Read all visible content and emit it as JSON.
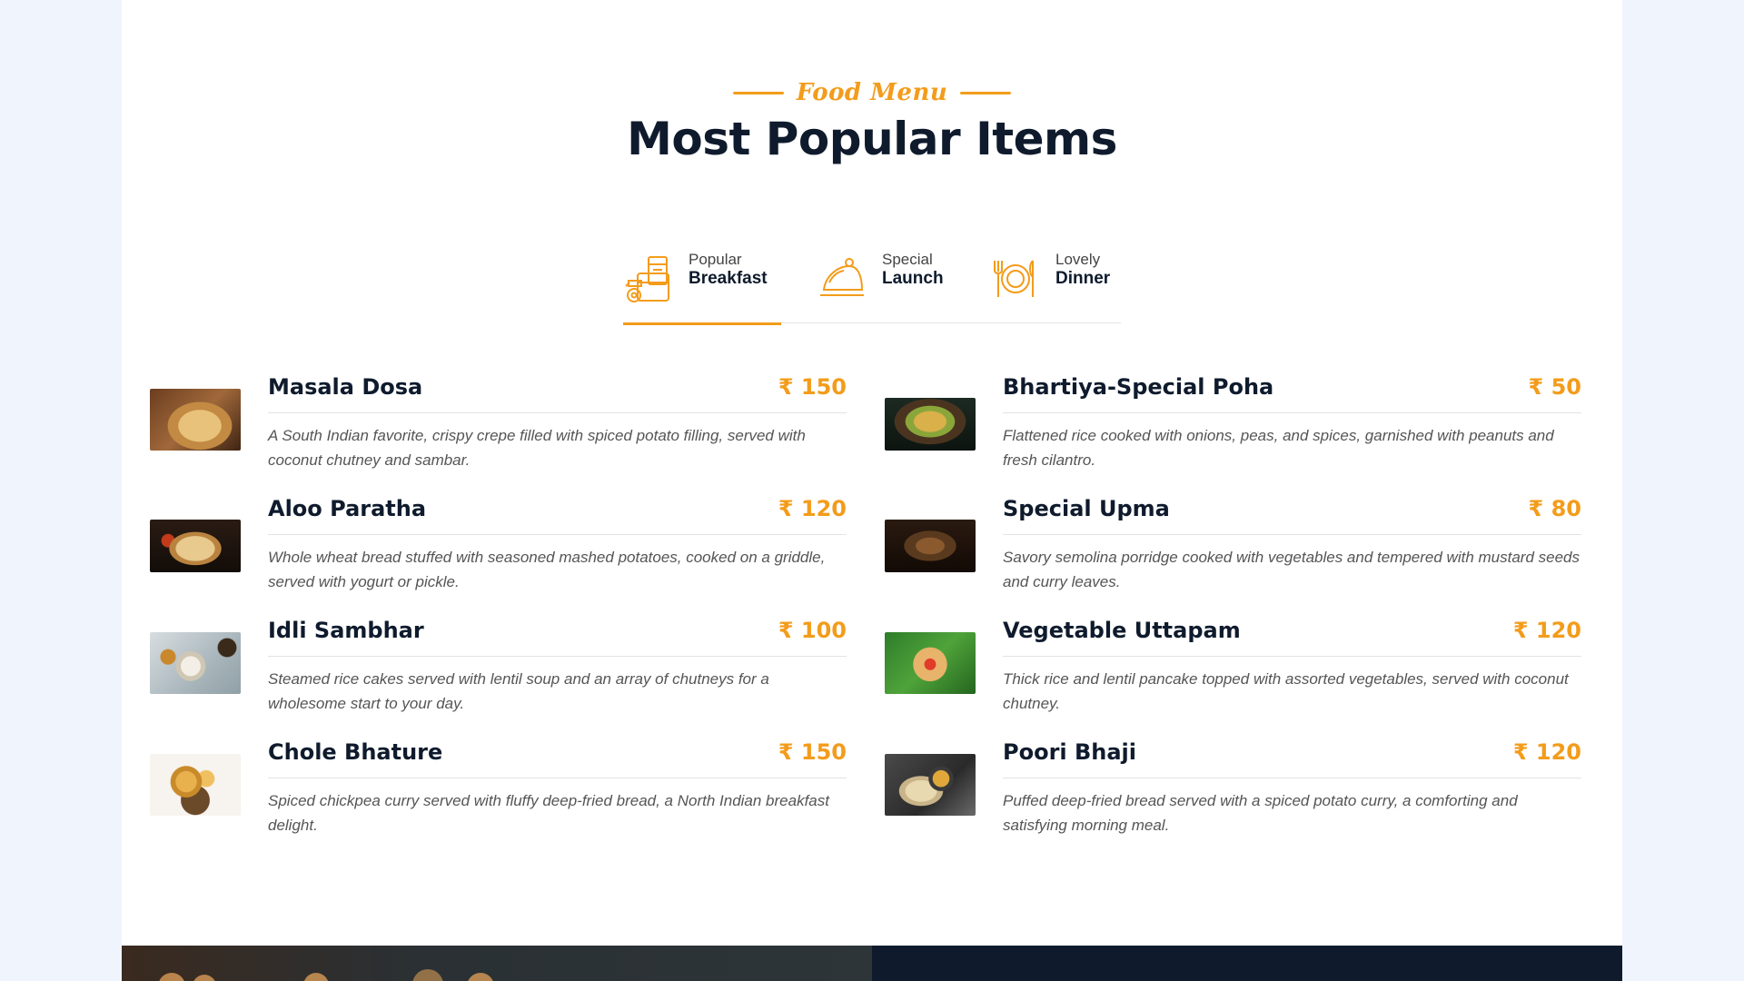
{
  "header": {
    "eyebrow": "Food Menu",
    "title": "Most Popular Items"
  },
  "tabs": [
    {
      "small": "Popular",
      "big": "Breakfast",
      "icon": "breakfast-icon",
      "active": true
    },
    {
      "small": "Special",
      "big": "Launch",
      "icon": "cloche-icon",
      "active": false
    },
    {
      "small": "Lovely",
      "big": "Dinner",
      "icon": "plate-cutlery-icon",
      "active": false
    }
  ],
  "items": [
    {
      "name": "Masala Dosa",
      "price": "₹ 150",
      "desc": "A South Indian favorite, crispy crepe filled with spiced potato filling, served with coconut chutney and sambar."
    },
    {
      "name": "Bhartiya-Special Poha",
      "price": "₹ 50",
      "desc": "Flattened rice cooked with onions, peas, and spices, garnished with peanuts and fresh cilantro."
    },
    {
      "name": "Aloo Paratha",
      "price": "₹ 120",
      "desc": "Whole wheat bread stuffed with seasoned mashed potatoes, cooked on a griddle, served with yogurt or pickle."
    },
    {
      "name": "Special Upma",
      "price": "₹ 80",
      "desc": "Savory semolina porridge cooked with vegetables and tempered with mustard seeds and curry leaves."
    },
    {
      "name": "Idli Sambhar",
      "price": "₹ 100",
      "desc": "Steamed rice cakes served with lentil soup and an array of chutneys for a wholesome start to your day."
    },
    {
      "name": "Vegetable Uttapam",
      "price": "₹ 120",
      "desc": "Thick rice and lentil pancake topped with assorted vegetables, served with coconut chutney."
    },
    {
      "name": "Chole Bhature",
      "price": "₹ 150",
      "desc": "Spiced chickpea curry served with fluffy deep-fried bread, a North Indian breakfast delight."
    },
    {
      "name": "Poori Bhaji",
      "price": "₹ 120",
      "desc": "Puffed deep-fried bread served with a spiced potato curry, a comforting and satisfying morning meal."
    }
  ],
  "colors": {
    "accent": "#f39c1b",
    "heading": "#0f1b2d",
    "text": "#555555",
    "page_bg": "#f0f5fd"
  }
}
